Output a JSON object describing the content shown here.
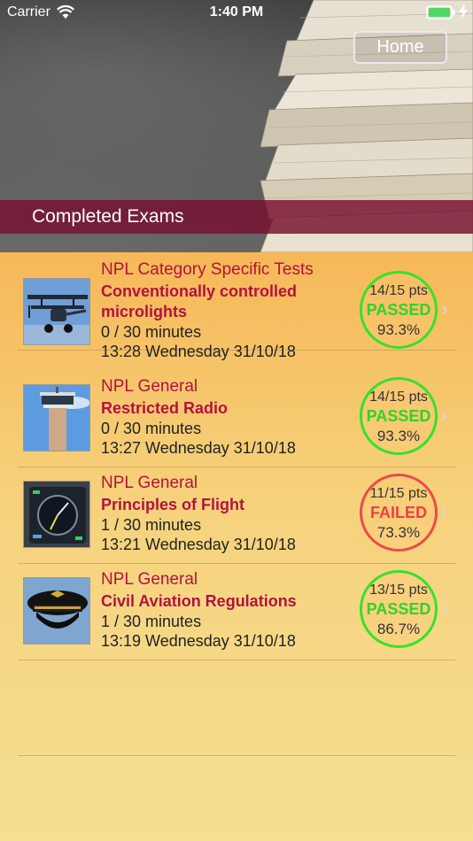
{
  "status_bar": {
    "carrier": "Carrier",
    "time": "1:40 PM"
  },
  "header": {
    "home_label": "Home",
    "title": "Completed Exams"
  },
  "exams": [
    {
      "category": "NPL Category Specific Tests",
      "name": "Conventionally controlled microlights",
      "duration": "0 / 30 minutes",
      "timestamp": "13:28 Wednesday 31/10/18",
      "points": "14/15 pts",
      "verdict": "PASSED",
      "percent": "93.3%",
      "icon": "microlight-aircraft-icon"
    },
    {
      "category": "NPL General",
      "name": "Restricted Radio",
      "duration": "0 / 30 minutes",
      "timestamp": "13:27 Wednesday 31/10/18",
      "points": "14/15 pts",
      "verdict": "PASSED",
      "percent": "93.3%",
      "icon": "control-tower-icon"
    },
    {
      "category": "NPL General",
      "name": "Principles of Flight",
      "duration": "1 / 30 minutes",
      "timestamp": "13:21 Wednesday 31/10/18",
      "points": "11/15 pts",
      "verdict": "FAILED",
      "percent": "73.3%",
      "icon": "flight-instrument-icon"
    },
    {
      "category": "NPL General",
      "name": "Civil Aviation Regulations",
      "duration": "1 / 30 minutes",
      "timestamp": "13:19 Wednesday 31/10/18",
      "points": "13/15 pts",
      "verdict": "PASSED",
      "percent": "86.7%",
      "icon": "pilot-cap-icon"
    }
  ],
  "colors": {
    "accent": "#b3123f",
    "pass": "#2fd22a",
    "fail": "#ea4141",
    "title_band": "#781030"
  }
}
